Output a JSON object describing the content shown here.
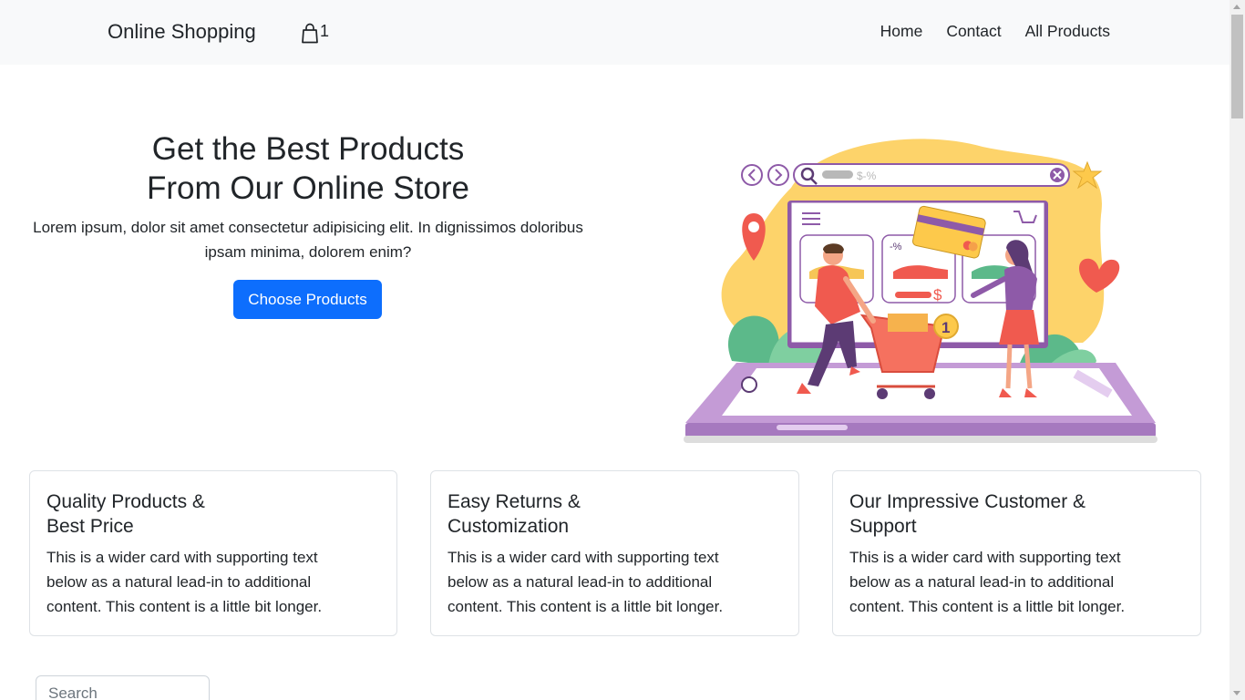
{
  "navbar": {
    "brand": "Online Shopping",
    "cart_icon": "shopping-bag-icon",
    "cart_count": "1",
    "links": [
      "Home",
      "Contact",
      "All Products"
    ]
  },
  "hero": {
    "title_line1": "Get the Best Products",
    "title_line2": "From Our Online Store",
    "text": "Lorem ipsum, dolor sit amet consectetur adipisicing elit. In dignissimos doloribus ipsam minima, dolorem enim?",
    "button_label": "Choose Products",
    "illustration": {
      "search_text": "$-%",
      "discount_text": "-%",
      "price_symbol": "$",
      "cart_badge": "1"
    }
  },
  "cards": [
    {
      "title_line1": "Quality Products &",
      "title_line2": "Best Price",
      "text": "This is a wider card with supporting text below as a natural lead-in to additional content. This content is a little bit longer."
    },
    {
      "title_line1": "Easy Returns &",
      "title_line2": "Customization",
      "text": "This is a wider card with supporting text below as a natural lead-in to additional content. This content is a little bit longer."
    },
    {
      "title_line1": "Our Impressive Customer &",
      "title_line2": "Support",
      "text": "This is a wider card with supporting text below as a natural lead-in to additional content. This content is a little bit longer."
    }
  ],
  "search": {
    "placeholder": "Search",
    "value": ""
  },
  "colors": {
    "primary": "#0d6efd",
    "navbar_bg": "#f8f9fa",
    "text": "#212529"
  }
}
